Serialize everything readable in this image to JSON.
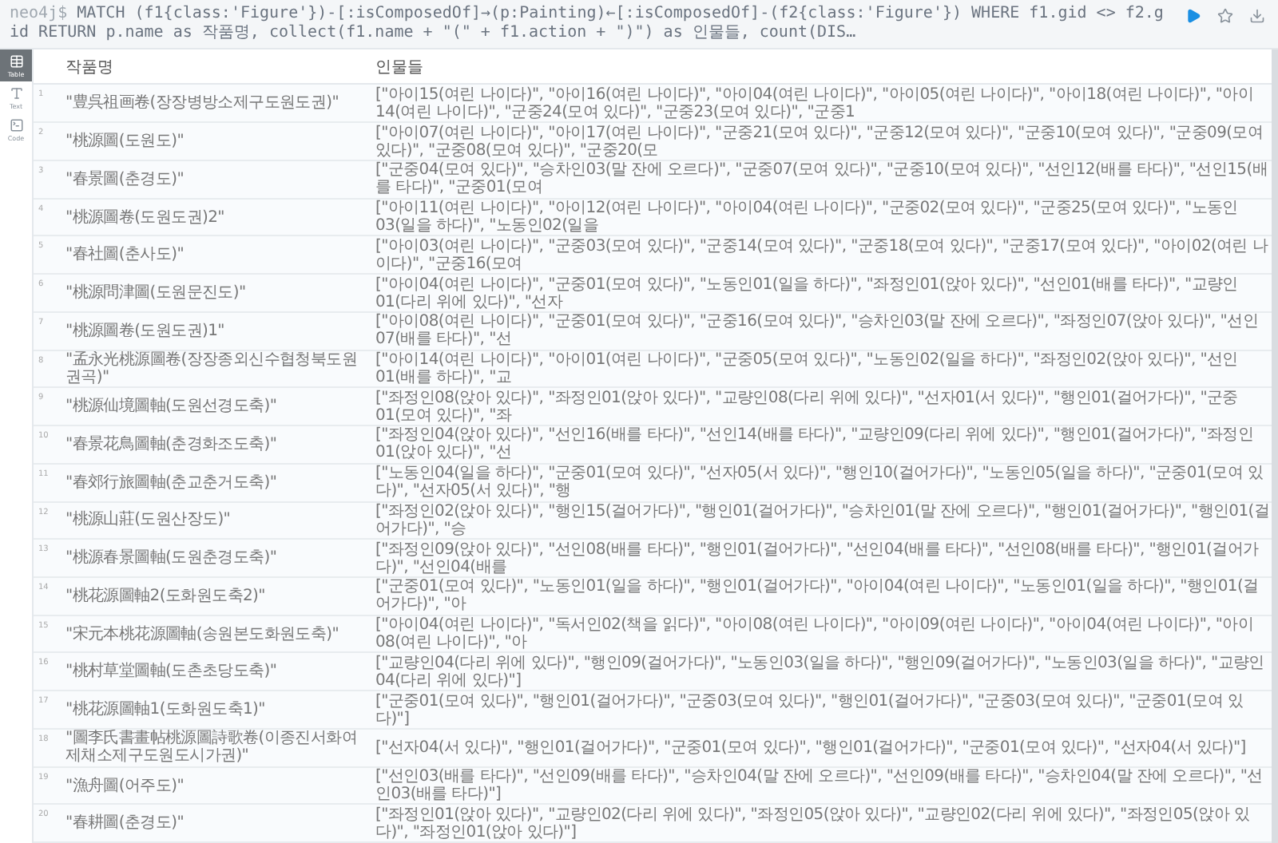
{
  "query_bar": {
    "prompt": "neo4j$",
    "query": "MATCH (f1{class:'Figure'})-[:isComposedOf]→(p:Painting)←[:isComposedOf]-(f2{class:'Figure'}) WHERE f1.gid <> f2.gid RETURN p.name as 작품명, collect(f1.name + \"(\" + f1.action + \")\") as 인물들, count(DIS…"
  },
  "view_tabs": [
    {
      "label": "Table",
      "selected": true
    },
    {
      "label": "Text",
      "selected": false
    },
    {
      "label": "Code",
      "selected": false
    }
  ],
  "table": {
    "columns": [
      "작품명",
      "인물들"
    ],
    "rows": [
      {
        "number": "1",
        "title": "\"豊呉祖画卷(장장병방소제구도원도권)\"",
        "people": "[\"아이15(여린 나이다)\", \"아이16(여린 나이다)\", \"아이04(여린 나이다)\", \"아이05(여린 나이다)\", \"아이18(여린 나이다)\", \"아이14(여린 나이다)\", \"군중24(모여 있다)\", \"군중23(모여 있다)\", \"군중1"
      },
      {
        "number": "2",
        "title": "\"桃源圖(도원도)\"",
        "people": "[\"아이07(여린 나이다)\", \"아이17(여린 나이다)\", \"군중21(모여 있다)\", \"군중12(모여 있다)\", \"군중10(모여 있다)\", \"군중09(모여 있다)\", \"군중08(모여 있다)\", \"군중20(모"
      },
      {
        "number": "3",
        "title": "\"春景圖(춘경도)\"",
        "people": "[\"군중04(모여 있다)\", \"승차인03(말 잔에 오르다)\", \"군중07(모여 있다)\", \"군중10(모여 있다)\", \"선인12(배를 타다)\", \"선인15(배를 타다)\", \"군중01(모여"
      },
      {
        "number": "4",
        "title": "\"桃源圖卷(도원도권)2\"",
        "people": "[\"아이11(여린 나이다)\", \"아이12(여린 나이다)\", \"아이04(여린 나이다)\", \"군중02(모여 있다)\", \"군중25(모여 있다)\", \"노동인03(일을 하다)\", \"노동인02(일을"
      },
      {
        "number": "5",
        "title": "\"春社圖(춘사도)\"",
        "people": "[\"아이03(여린 나이다)\", \"군중03(모여 있다)\", \"군중14(모여 있다)\", \"군중18(모여 있다)\", \"군중17(모여 있다)\", \"아이02(여린 나이다)\", \"군중16(모여"
      },
      {
        "number": "6",
        "title": "\"桃源問津圖(도원문진도)\"",
        "people": "[\"아이04(여린 나이다)\", \"군중01(모여 있다)\", \"노동인01(일을 하다)\", \"좌정인01(앉아 있다)\", \"선인01(배를 타다)\", \"교량인01(다리 위에 있다)\", \"선자"
      },
      {
        "number": "7",
        "title": "\"桃源圖卷(도원도권)1\"",
        "people": "[\"아이08(여린 나이다)\", \"군중01(모여 있다)\", \"군중16(모여 있다)\", \"승차인03(말 잔에 오르다)\", \"좌정인07(앉아 있다)\", \"선인07(배를 타다)\", \"선"
      },
      {
        "number": "8",
        "title": "\"孟永光桃源圖卷(장장종외신수협청북도원권곡)\"",
        "people": "[\"아이14(여린 나이다)\", \"아이01(여린 나이다)\", \"군중05(모여 있다)\", \"노동인02(일을 하다)\", \"좌정인02(앉아 있다)\", \"선인01(배를 하다)\", \"교"
      },
      {
        "number": "9",
        "title": "\"桃源仙境圖軸(도원선경도축)\"",
        "people": "[\"좌정인08(앉아 있다)\", \"좌정인01(앉아 있다)\", \"교량인08(다리 위에 있다)\", \"선자01(서 있다)\", \"행인01(걸어가다)\", \"군중01(모여 있다)\", \"좌"
      },
      {
        "number": "10",
        "title": "\"春景花鳥圖軸(춘경화조도축)\"",
        "people": "[\"좌정인04(앉아 있다)\", \"선인16(배를 타다)\", \"선인14(배를 타다)\", \"교량인09(다리 위에 있다)\", \"행인01(걸어가다)\", \"좌정인01(앉아 있다)\", \"선"
      },
      {
        "number": "11",
        "title": "\"春郊行旅圖軸(춘교춘거도축)\"",
        "people": "[\"노동인04(일을 하다)\", \"군중01(모여 있다)\", \"선자05(서 있다)\", \"행인10(걸어가다)\", \"노동인05(일을 하다)\", \"군중01(모여 있다)\", \"선자05(서 있다)\", \"행"
      },
      {
        "number": "12",
        "title": "\"桃源山莊(도원산장도)\"",
        "people": "[\"좌정인02(앉아 있다)\", \"행인15(걸어가다)\", \"행인01(걸어가다)\", \"승차인01(말 잔에 오르다)\", \"행인01(걸어가다)\", \"행인01(걸어가다)\", \"승"
      },
      {
        "number": "13",
        "title": "\"桃源春景圖軸(도원춘경도축)\"",
        "people": "[\"좌정인09(앉아 있다)\", \"선인08(배를 타다)\", \"행인01(걸어가다)\", \"선인04(배를 타다)\", \"선인08(배를 타다)\", \"행인01(걸어가다)\", \"선인04(배를"
      },
      {
        "number": "14",
        "title": "\"桃花源圖軸2(도화원도축2)\"",
        "people": "[\"군중01(모여 있다)\", \"노동인01(일을 하다)\", \"행인01(걸어가다)\", \"아이04(여린 나이다)\", \"노동인01(일을 하다)\", \"행인01(걸어가다)\", \"아"
      },
      {
        "number": "15",
        "title": "\"宋元本桃花源圖軸(송원본도화원도축)\"",
        "people": "[\"아이04(여린 나이다)\", \"독서인02(책을 읽다)\", \"아이08(여린 나이다)\", \"아이09(여린 나이다)\", \"아이04(여린 나이다)\", \"아이08(여린 나이다)\", \"아"
      },
      {
        "number": "16",
        "title": "\"桃村草堂圖軸(도촌초당도축)\"",
        "people": "[\"교량인04(다리 위에 있다)\", \"행인09(걸어가다)\", \"노동인03(일을 하다)\", \"행인09(걸어가다)\", \"노동인03(일을 하다)\", \"교량인04(다리 위에 있다)\"]"
      },
      {
        "number": "17",
        "title": "\"桃花源圖軸1(도화원도축1)\"",
        "people": "[\"군중01(모여 있다)\", \"행인01(걸어가다)\", \"군중03(모여 있다)\", \"행인01(걸어가다)\", \"군중03(모여 있다)\", \"군중01(모여 있다)\"]"
      },
      {
        "number": "18",
        "title": "\"圖李氏書畫帖桃源圖詩歌卷(이종진서화여제채소제구도원도시가권)\"",
        "people": "[\"선자04(서 있다)\", \"행인01(걸어가다)\", \"군중01(모여 있다)\", \"행인01(걸어가다)\", \"군중01(모여 있다)\", \"선자04(서 있다)\"]"
      },
      {
        "number": "19",
        "title": "\"漁舟圖(어주도)\"",
        "people": "[\"선인03(배를 타다)\", \"선인09(배를 타다)\", \"승차인04(말 잔에 오르다)\", \"선인09(배를 타다)\", \"승차인04(말 잔에 오르다)\", \"선인03(배를 타다)\"]"
      },
      {
        "number": "20",
        "title": "\"春耕圖(춘경도)\"",
        "people": "[\"좌정인01(앉아 있다)\", \"교량인02(다리 위에 있다)\", \"좌정인05(앉아 있다)\", \"교량인02(다리 위에 있다)\", \"좌정인05(앉아 있다)\", \"좌정인01(앉아 있다)\"]"
      }
    ]
  }
}
